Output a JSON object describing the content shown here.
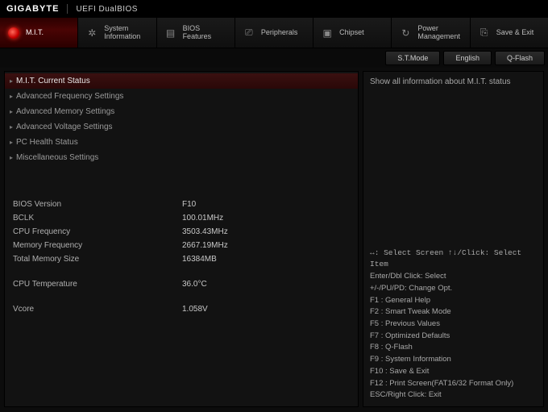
{
  "brand": {
    "name": "GIGABYTE",
    "product": "UEFI DualBIOS"
  },
  "tabs": [
    {
      "line1": "",
      "line2": "M.I.T."
    },
    {
      "line1": "System",
      "line2": "Information"
    },
    {
      "line1": "BIOS",
      "line2": "Features"
    },
    {
      "line1": "",
      "line2": "Peripherals"
    },
    {
      "line1": "",
      "line2": "Chipset"
    },
    {
      "line1": "Power",
      "line2": "Management"
    },
    {
      "line1": "",
      "line2": "Save & Exit"
    }
  ],
  "subbar": {
    "stmode": "S.T.Mode",
    "lang": "English",
    "qflash": "Q-Flash"
  },
  "menu": [
    "M.I.T. Current Status",
    "Advanced Frequency Settings",
    "Advanced Memory Settings",
    "Advanced Voltage Settings",
    "PC Health Status",
    "Miscellaneous Settings"
  ],
  "info": {
    "bios_version_k": "BIOS Version",
    "bios_version_v": "F10",
    "bclk_k": "BCLK",
    "bclk_v": "100.01MHz",
    "cpu_freq_k": "CPU Frequency",
    "cpu_freq_v": "3503.43MHz",
    "mem_freq_k": "Memory Frequency",
    "mem_freq_v": "2667.19MHz",
    "total_mem_k": "Total Memory Size",
    "total_mem_v": "16384MB",
    "cpu_temp_k": "CPU Temperature",
    "cpu_temp_v": "36.0°C",
    "vcore_k": "Vcore",
    "vcore_v": "1.058V"
  },
  "right": {
    "desc": "Show all information about M.I.T. status",
    "hk_select_screen": "↔: Select Screen   ↑↓/Click: Select Item",
    "hk_enter": "Enter/Dbl Click: Select",
    "hk_change": "+/-/PU/PD: Change Opt.",
    "hk_f1": "F1  : General Help",
    "hk_f2": "F2  : Smart Tweak Mode",
    "hk_f5": "F5  : Previous Values",
    "hk_f7": "F7  : Optimized Defaults",
    "hk_f8": "F8  : Q-Flash",
    "hk_f9": "F9  : System Information",
    "hk_f10": "F10 : Save & Exit",
    "hk_f12": "F12 : Print Screen(FAT16/32 Format Only)",
    "hk_esc": "ESC/Right Click: Exit"
  }
}
